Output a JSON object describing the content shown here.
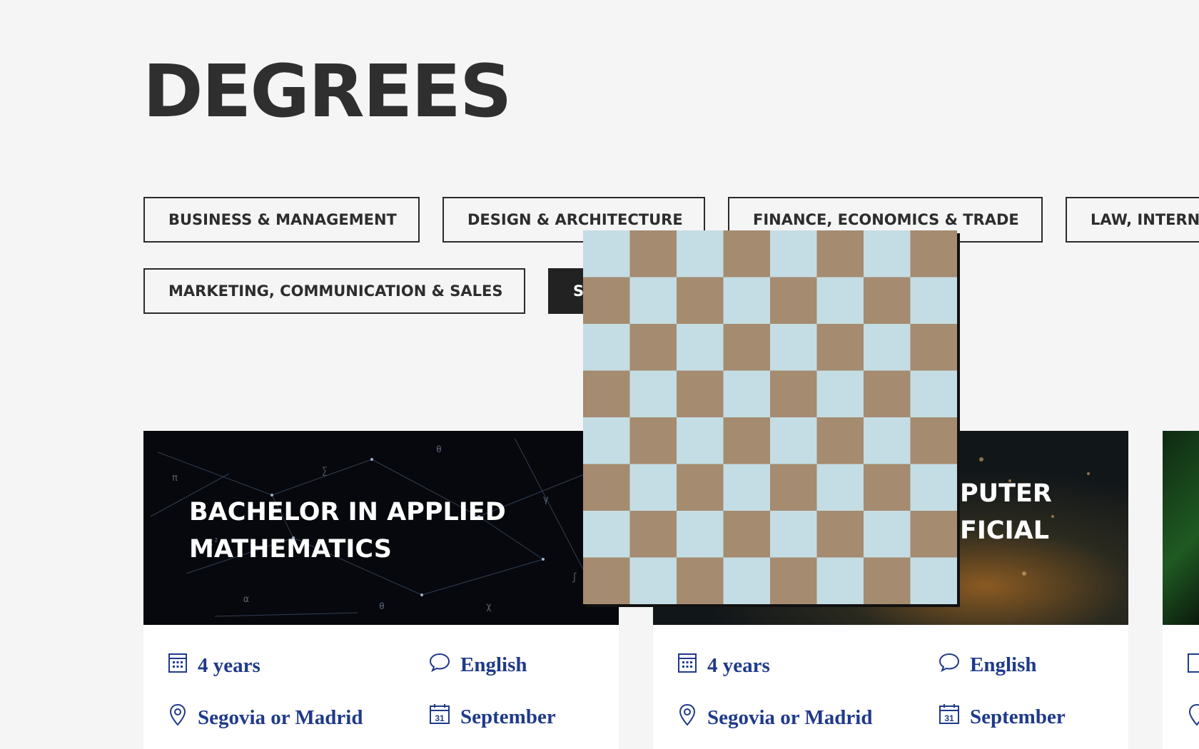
{
  "page": {
    "title": "DEGREES"
  },
  "filters": [
    {
      "label": "BUSINESS & MANAGEMENT",
      "active": false
    },
    {
      "label": "DESIGN & ARCHITECTURE",
      "active": false
    },
    {
      "label": "FINANCE, ECONOMICS & TRADE",
      "active": false
    },
    {
      "label": "LAW, INTERN",
      "active": false
    },
    {
      "label": "MARKETING, COMMUNICATION & SALES",
      "active": false
    },
    {
      "label": "S",
      "active": true
    }
  ],
  "cards": [
    {
      "title": "BACHELOR IN APPLIED MATHEMATICS",
      "duration": "4 years",
      "language": "English",
      "location": "Segovia or Madrid",
      "start": "September"
    },
    {
      "title_visible_lines": [
        "PUTER",
        "FICIAL"
      ],
      "duration": "4 years",
      "language": "English",
      "location": "Segovia or Madrid",
      "start": "September"
    }
  ],
  "icons": {
    "duration": "calendar-grid-icon",
    "language": "speech-bubble-icon",
    "location": "map-pin-icon",
    "start": "calendar-31-icon",
    "calendar_day": "31"
  },
  "colors": {
    "background": "#f5f5f5",
    "text_dark": "#2f2f2f",
    "meta_blue": "#1f3a8a",
    "overlay_light": "#c4dde4",
    "overlay_dark": "#a58b6f"
  }
}
